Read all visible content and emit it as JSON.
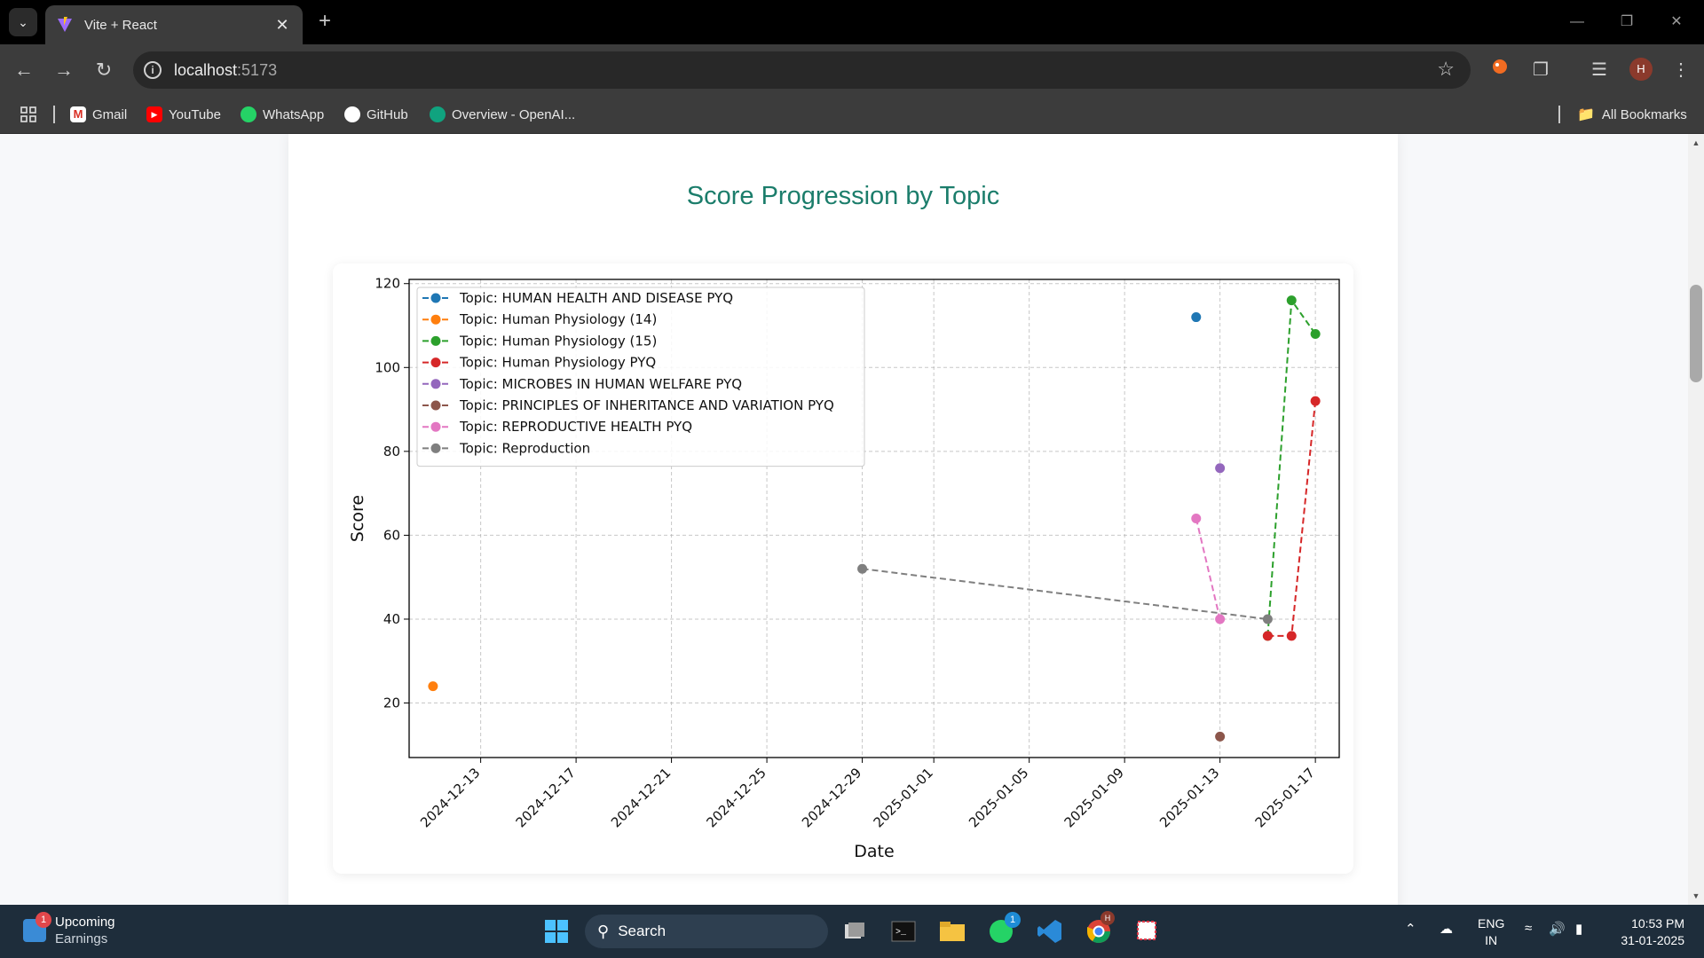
{
  "browser": {
    "tab_title": "Vite + React",
    "url_host": "localhost",
    "url_port": ":5173",
    "profile_initial": "H",
    "bookmarks": [
      "Gmail",
      "YouTube",
      "WhatsApp",
      "GitHub",
      "Overview - OpenAI..."
    ],
    "all_bookmarks": "All Bookmarks"
  },
  "page": {
    "card_title": "Score Progression by Topic"
  },
  "chart_data": {
    "type": "line",
    "xlabel": "Date",
    "ylabel": "Score",
    "ylim": [
      7,
      121
    ],
    "xlim": [
      "2024-12-10",
      "2025-01-18"
    ],
    "yticks": [
      20,
      40,
      60,
      80,
      100,
      120
    ],
    "xticks": [
      "2024-12-13",
      "2024-12-17",
      "2024-12-21",
      "2024-12-25",
      "2024-12-29",
      "2025-01-01",
      "2025-01-05",
      "2025-01-09",
      "2025-01-13",
      "2025-01-17"
    ],
    "grid": true,
    "legend_position": "top-left",
    "series": [
      {
        "name": "Topic: HUMAN HEALTH AND DISEASE PYQ",
        "color": "#1f77b4",
        "points": [
          [
            "2025-01-12",
            112
          ]
        ]
      },
      {
        "name": "Topic: Human Physiology (14)",
        "color": "#ff7f0e",
        "points": [
          [
            "2024-12-11",
            24
          ]
        ]
      },
      {
        "name": "Topic: Human Physiology (15)",
        "color": "#2ca02c",
        "points": [
          [
            "2025-01-15",
            36
          ],
          [
            "2025-01-16",
            116
          ],
          [
            "2025-01-17",
            108
          ]
        ]
      },
      {
        "name": "Topic: Human Physiology PYQ",
        "color": "#d62728",
        "points": [
          [
            "2025-01-15",
            36
          ],
          [
            "2025-01-16",
            36
          ],
          [
            "2025-01-17",
            92
          ]
        ]
      },
      {
        "name": "Topic: MICROBES IN HUMAN WELFARE  PYQ",
        "color": "#9467bd",
        "points": [
          [
            "2025-01-13",
            76
          ]
        ]
      },
      {
        "name": "Topic: PRINCIPLES OF INHERITANCE AND VARIATION PYQ",
        "color": "#8c564b",
        "points": [
          [
            "2025-01-13",
            12
          ]
        ]
      },
      {
        "name": "Topic: REPRODUCTIVE HEALTH PYQ",
        "color": "#e377c2",
        "points": [
          [
            "2025-01-12",
            64
          ],
          [
            "2025-01-13",
            40
          ]
        ]
      },
      {
        "name": "Topic: Reproduction",
        "color": "#7f7f7f",
        "points": [
          [
            "2024-12-29",
            52
          ],
          [
            "2025-01-15",
            40
          ]
        ]
      }
    ]
  },
  "taskbar": {
    "widget_badge": "1",
    "widget_title": "Upcoming",
    "widget_sub": "Earnings",
    "search_label": "Search",
    "whatsapp_badge": "1",
    "chrome_badge": "H",
    "lang_top": "ENG",
    "lang_bottom": "IN",
    "time": "10:53 PM",
    "date": "31-01-2025"
  }
}
